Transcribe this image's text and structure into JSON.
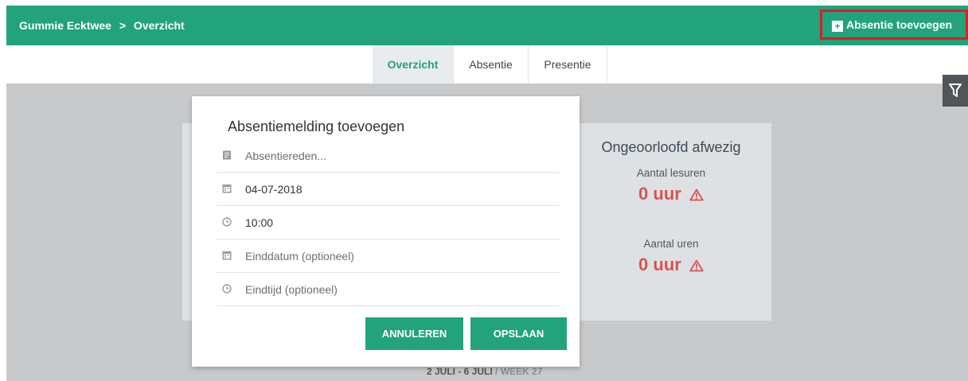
{
  "header": {
    "breadcrumb_root": "Gummie Ecktwee",
    "breadcrumb_separator": ">",
    "breadcrumb_current": "Overzicht",
    "add_absence_label": "Absentie toevoegen",
    "accent_color": "#22a37c"
  },
  "tabs": [
    {
      "label": "Overzicht",
      "active": true
    },
    {
      "label": "Absentie",
      "active": false
    },
    {
      "label": "Presentie",
      "active": false
    }
  ],
  "filter_icon": "filter-icon",
  "stats": {
    "title": "Ongeoorloofd afwezig",
    "lesuren_label": "Aantal lesuren",
    "lesuren_value": "0 uur",
    "uren_label": "Aantal uren",
    "uren_value": "0 uur",
    "value_color": "#d9534f"
  },
  "week": {
    "range": "2 JULI - 6 JULI",
    "sep": " / ",
    "week": "WEEK 27"
  },
  "modal": {
    "title": "Absentiemelding toevoegen",
    "fields": [
      {
        "icon": "document-icon",
        "text": "Absentiereden...",
        "placeholder": true
      },
      {
        "icon": "calendar-icon",
        "text": "04-07-2018",
        "placeholder": false
      },
      {
        "icon": "clock-icon",
        "text": "10:00",
        "placeholder": false
      },
      {
        "icon": "calendar-icon",
        "text": "Einddatum (optioneel)",
        "placeholder": true
      },
      {
        "icon": "clock-icon",
        "text": "Eindtijd (optioneel)",
        "placeholder": true
      }
    ],
    "cancel_label": "ANNULEREN",
    "save_label": "OPSLAAN"
  }
}
